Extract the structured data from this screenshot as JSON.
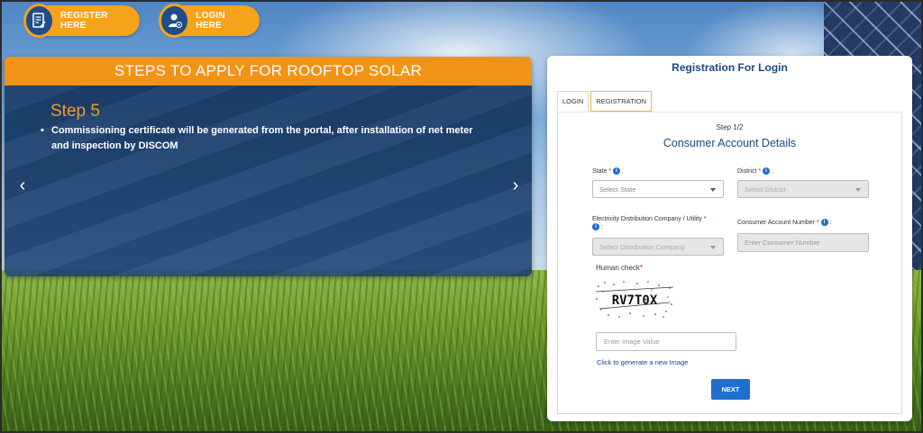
{
  "top_buttons": {
    "register_label": "REGISTER HERE",
    "login_label": "LOGIN HERE"
  },
  "steps_panel": {
    "header": "STEPS TO APPLY FOR ROOFTOP SOLAR",
    "step_title": "Step 5",
    "step_text": "Commissioning certificate will be generated from the portal, after installation of net meter and inspection by DISCOM",
    "prev_arrow": "‹",
    "next_arrow": "›"
  },
  "registration": {
    "title": "Registration For Login",
    "tabs": [
      {
        "label": "LOGIN",
        "active": false
      },
      {
        "label": "REGISTRATION",
        "active": true
      }
    ],
    "step_count": "Step 1/2",
    "section_title": "Consumer Account Details",
    "state": {
      "label": "State",
      "placeholder": "Select State"
    },
    "district": {
      "label": "District",
      "placeholder": "Select District"
    },
    "discom": {
      "label": "Electricity Distribution Company / Utility",
      "placeholder": "Select Distribution Company"
    },
    "consumer_number": {
      "label": "Consumer Account Number",
      "placeholder": "Enter Consumer Number"
    },
    "human_check_label": "Human check",
    "captcha_text": "RV7T0X",
    "captcha_input_placeholder": "Enter Image Value",
    "regenerate_link": "Click to generate a new Image",
    "next_button": "NEXT"
  },
  "colors": {
    "accent_orange": "#f29317",
    "primary_blue": "#1f6fcf",
    "title_blue": "#1c4a7e"
  }
}
